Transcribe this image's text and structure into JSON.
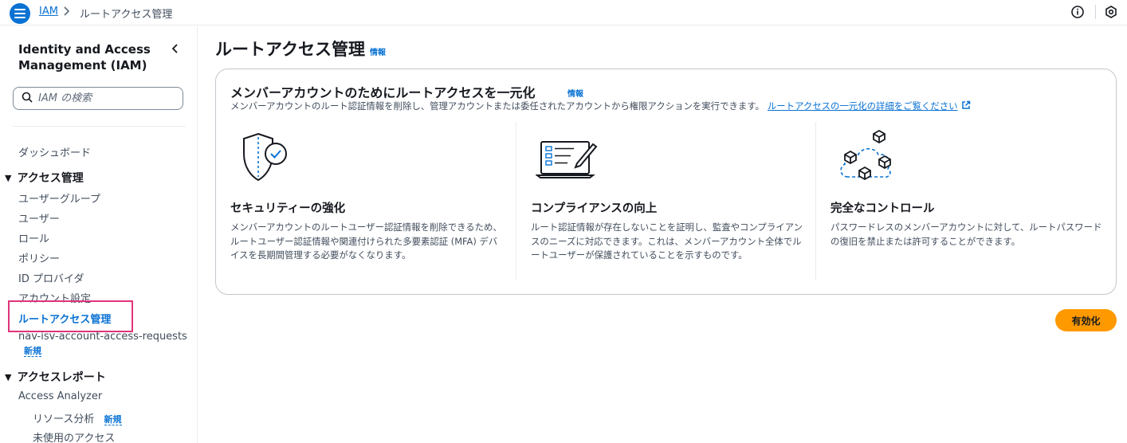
{
  "topbar": {
    "breadcrumb_service": "IAM",
    "breadcrumb_current": "ルートアクセス管理"
  },
  "sidebar": {
    "title": "Identity and Access Management (IAM)",
    "search_placeholder": "IAM の検索",
    "dashboard": "ダッシュボード",
    "access_mgmt_section": "アクセス管理",
    "access_items": [
      "ユーザーグループ",
      "ユーザー",
      "ロール",
      "ポリシー",
      "ID プロバイダ",
      "アカウント設定"
    ],
    "active_item": "ルートアクセス管理",
    "isv_item": "nav-isv-account-access-requests",
    "new_badge": "新規",
    "reports_section": "アクセスレポート",
    "access_analyzer": "Access Analyzer",
    "resource_analysis": "リソース分析",
    "unused_access": "未使用のアクセス"
  },
  "main": {
    "title": "ルートアクセス管理",
    "info_label": "情報",
    "card": {
      "title": "メンバーアカウントのためにルートアクセスを一元化",
      "description": "メンバーアカウントのルート認証情報を削除し、管理アカウントまたは委任されたアカウントから権限アクションを実行できます。",
      "link": "ルートアクセスの一元化の詳細をご覧ください",
      "features": [
        {
          "icon": "shield-check-icon",
          "title": "セキュリティーの強化",
          "body": "メンバーアカウントのルートユーザー認証情報を削除できるため、ルートユーザー認証情報や関連付けられた多要素認証 (MFA) デバイスを長期間管理する必要がなくなります。"
        },
        {
          "icon": "laptop-checklist-icon",
          "title": "コンプライアンスの向上",
          "body": "ルート認証情報が存在しないことを証明し、監査やコンプライアンスのニーズに対応できます。これは、メンバーアカウント全体でルートユーザーが保護されていることを示すものです。"
        },
        {
          "icon": "cloud-cubes-icon",
          "title": "完全なコントロール",
          "body": "パスワードレスのメンバーアカウントに対して、ルートパスワードの復旧を禁止または許可することができます。"
        }
      ]
    },
    "enable_button": "有効化"
  },
  "colors": {
    "accent": "#0972d3",
    "primary_button": "#ff9900",
    "active_outline": "#e0347a"
  }
}
